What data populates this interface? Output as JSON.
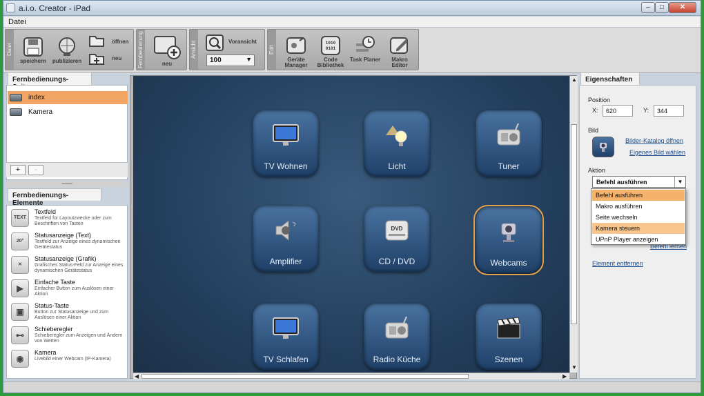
{
  "window": {
    "title": "a.i.o. Creator - iPad",
    "minimize": "–",
    "maximize": "□",
    "close": "✕"
  },
  "menu": {
    "datei": "Datei"
  },
  "toolbar": {
    "groups": {
      "datei": "Datei",
      "fernbedienung": "Fernbedienung",
      "ansicht": "Ansicht",
      "edit": "Edit"
    },
    "speichern": "speichern",
    "publizieren": "publizieren",
    "oeffnen": "öffnen",
    "neu": "neu",
    "neu2": "neu",
    "voransicht": "Voransicht",
    "zoom": "100",
    "geraete_manager": "Geräte Manager",
    "code_bibliothek": "Code Bibliothek",
    "task_planer": "Task Planer",
    "makro_editor": "Makro Editor"
  },
  "pages_panel": {
    "header": "Fernbedienungs-Seiten",
    "items": [
      {
        "label": "index",
        "selected": true
      },
      {
        "label": "Kamera",
        "selected": false
      }
    ],
    "add": "+",
    "remove": "-"
  },
  "elements_panel": {
    "header": "Fernbedienungs-Elemente",
    "items": [
      {
        "title": "Textfeld",
        "desc": "Textfeld für Layoutzwecke oder zum Beschriften von Tasten",
        "icon": "TEXT"
      },
      {
        "title": "Statusanzeige (Text)",
        "desc": "Textfeld zur Anzeige eines dynamischen Gerätestatus",
        "icon": "20°"
      },
      {
        "title": "Statusanzeige (Grafik)",
        "desc": "Grafisches Status-Feld zur Anzeige eines dynamischen Gerätestatus",
        "icon": "status-graphic-icon"
      },
      {
        "title": "Einfache Taste",
        "desc": "Einfacher Button zum Auslösen einer Aktion",
        "icon": "play-icon"
      },
      {
        "title": "Status-Taste",
        "desc": "Button zur Statusanzeige und zum Auslösen einer Aktion",
        "icon": "status-button-icon"
      },
      {
        "title": "Schieberegler",
        "desc": "Schieberegler zum Anzeigen und Ändern von Werten",
        "icon": "slider-icon"
      },
      {
        "title": "Kamera",
        "desc": "Livebild einer Webcam (IP-Kamera)",
        "icon": "camera-icon"
      }
    ]
  },
  "canvas": {
    "tiles": [
      {
        "label": "TV Wohnen",
        "icon": "tv-icon"
      },
      {
        "label": "Licht",
        "icon": "lamp-icon"
      },
      {
        "label": "Tuner",
        "icon": "radio-icon"
      },
      {
        "label": "Amplifier",
        "icon": "speaker-icon"
      },
      {
        "label": "CD / DVD",
        "icon": "dvd-icon"
      },
      {
        "label": "Webcams",
        "icon": "webcam-icon",
        "selected": true
      },
      {
        "label": "TV Schlafen",
        "icon": "tv-icon"
      },
      {
        "label": "Radio Küche",
        "icon": "radio-icon"
      },
      {
        "label": "Szenen",
        "icon": "clapperboard-icon"
      }
    ]
  },
  "properties": {
    "header": "Eigenschaften",
    "position_label": "Position",
    "x_label": "X:",
    "x_value": "620",
    "y_label": "Y:",
    "y_value": "344",
    "bild_label": "Bild",
    "bilder_katalog": "Bilder-Katalog öffnen",
    "eigenes_bild": "Eigenes Bild wählen",
    "aktion_label": "Aktion",
    "aktion_value": "Befehl ausführen",
    "aktion_options": [
      {
        "label": "Befehl ausführen",
        "state": "selected"
      },
      {
        "label": "Makro ausführen",
        "state": ""
      },
      {
        "label": "Seite wechseln",
        "state": ""
      },
      {
        "label": "Kamera steuern",
        "state": "hover"
      },
      {
        "label": "UPnP Player anzeigen",
        "state": ""
      }
    ],
    "befehl_lernen": "Befehl lernen",
    "element_entfernen": "Element entfernen"
  }
}
